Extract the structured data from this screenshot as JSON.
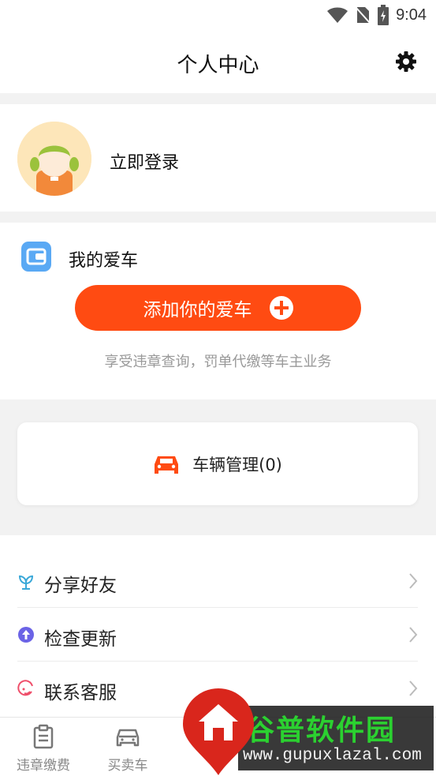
{
  "status_bar": {
    "time": "9:04"
  },
  "header": {
    "title": "个人中心",
    "settings_icon": "gear-icon"
  },
  "profile": {
    "login_label": "立即登录"
  },
  "my_car": {
    "title": "我的爱车",
    "add_button_label": "添加你的爱车",
    "subtitle": "享受违章查询，罚单代缴等车主业务",
    "accent_color": "#ff4b12"
  },
  "vehicle_management": {
    "label": "车辆管理(0)"
  },
  "menu": {
    "items": [
      {
        "label": "分享好友",
        "icon": "share-flower-icon"
      },
      {
        "label": "检查更新",
        "icon": "update-arrow-icon"
      },
      {
        "label": "联系客服",
        "icon": "customer-service-icon"
      }
    ]
  },
  "tabbar": {
    "tabs": [
      {
        "label": "违章缴费",
        "icon": "clipboard-icon"
      },
      {
        "label": "买卖车",
        "icon": "car-icon"
      }
    ]
  },
  "watermark": {
    "title": "谷普软件园",
    "url": "www.gupuxlazal.com"
  }
}
